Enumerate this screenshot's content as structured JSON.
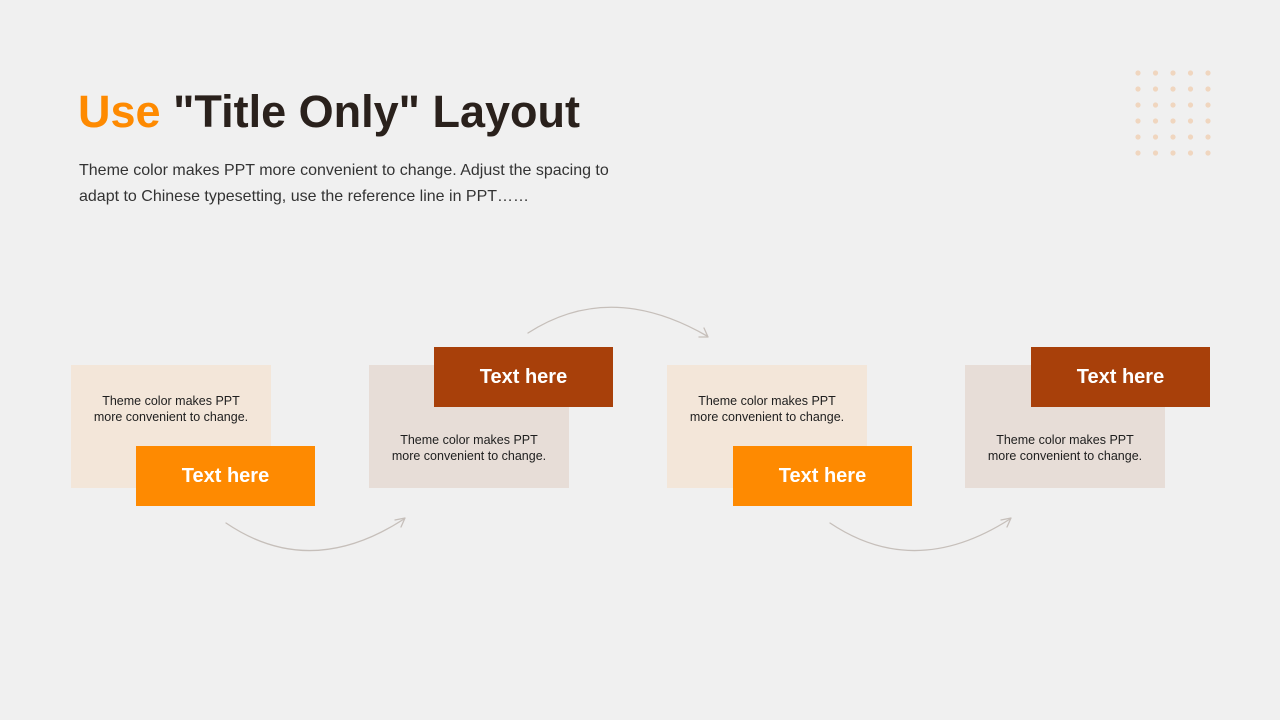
{
  "header": {
    "title_accent": "Use",
    "title_rest": " \"Title Only\" Layout",
    "subtitle": "Theme color makes PPT more convenient to change. Adjust the spacing to adapt to Chinese typesetting, use the reference line in PPT……"
  },
  "colors": {
    "background": "#f0f0f0",
    "title": "#2a211c",
    "accent_orange": "#fe8a01",
    "accent_rust": "#a8400a",
    "card_light": "#f3e6d9",
    "card_grey": "#e7ddd7",
    "dots": "#f0d6bf",
    "arrow": "#c6bfba"
  },
  "steps": [
    {
      "label": "Text here",
      "text": "Theme  color makes PPT\nmore convenient  to change."
    },
    {
      "label": "Text here",
      "text": "Theme  color makes PPT\nmore convenient  to change."
    },
    {
      "label": "Text here",
      "text": "Theme  color makes PPT\nmore convenient  to change."
    },
    {
      "label": "Text here",
      "text": "Theme  color makes PPT\nmore convenient  to change."
    }
  ]
}
